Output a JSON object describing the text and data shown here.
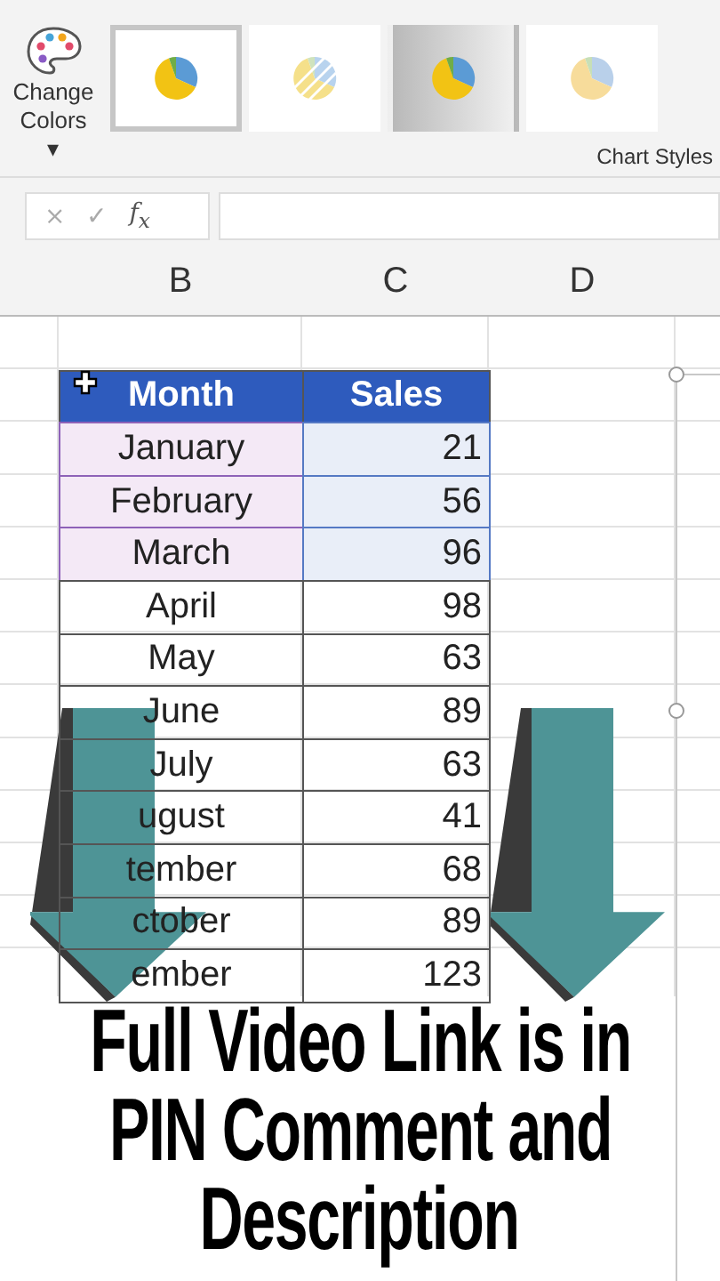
{
  "ribbon": {
    "change_colors": {
      "label": "Change Colors",
      "caret": "▾"
    },
    "chart_styles": [
      {
        "kind": "solid",
        "selected": true
      },
      {
        "kind": "pattern",
        "selected": false
      },
      {
        "kind": "gradient",
        "selected": false
      },
      {
        "kind": "pale",
        "selected": false
      }
    ],
    "group_label": "Chart Styles"
  },
  "formula_bar": {
    "buttons": [
      "×",
      "✓",
      "f$_{x}$"
    ]
  },
  "sheet": {
    "columns": [
      "B",
      "C",
      "D"
    ],
    "table": {
      "headers": [
        "Month",
        "Sales"
      ],
      "rows": [
        {
          "month": "January",
          "sales": "21",
          "in_range": true
        },
        {
          "month": "February",
          "sales": "56",
          "in_range": true
        },
        {
          "month": "March",
          "sales": "96",
          "in_range": true
        },
        {
          "month": "April",
          "sales": "98",
          "in_range": false
        },
        {
          "month": "May",
          "sales": "63",
          "in_range": false
        },
        {
          "month": "June",
          "sales": "89",
          "in_range": false
        },
        {
          "month": "July",
          "sales": "63",
          "in_range": false
        },
        {
          "month": "ugust",
          "sales": "41",
          "in_range": false
        },
        {
          "month": "tember",
          "sales": "68",
          "in_range": false
        },
        {
          "month": "ctober",
          "sales": "89",
          "in_range": false
        },
        {
          "month": "ember",
          "sales": "123",
          "in_range": false
        }
      ]
    }
  },
  "caption": [
    "Full Video Link is in",
    "PIN Comment and",
    "Description"
  ]
}
